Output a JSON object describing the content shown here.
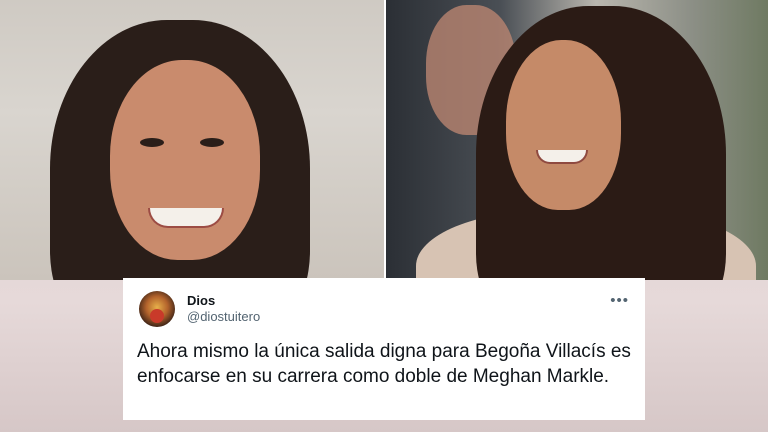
{
  "tweet": {
    "display_name": "Dios",
    "handle": "@diostuitero",
    "more_icon": "•••",
    "text": "Ahora mismo la única salida digna para Begoña Villacís es enfocarse en su carrera como doble de Meghan Markle."
  },
  "colors": {
    "tweet_bg": "#ffffff",
    "text": "#0f1419",
    "secondary_text": "#536471"
  }
}
